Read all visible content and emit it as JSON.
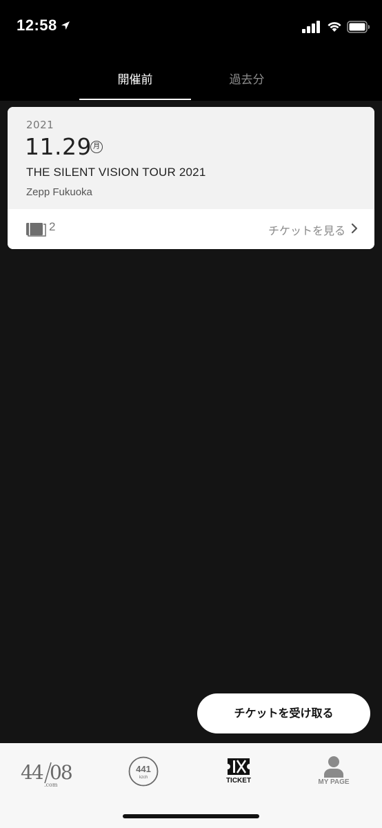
{
  "status_bar": {
    "time": "12:58"
  },
  "tabs": [
    {
      "label": "開催前",
      "selected": true
    },
    {
      "label": "過去分",
      "selected": false
    }
  ],
  "ticket_card": {
    "year": "2021",
    "date": "11.29",
    "weekday": "月",
    "title": "THE SILENT VISION TOUR 2021",
    "venue": "Zepp Fukuoka",
    "ticket_count": "2",
    "view_tickets_label": "チケットを見る"
  },
  "receive_button": {
    "label": "チケットを受け取る"
  },
  "bottom_nav": {
    "items": [
      {
        "icon": "4408-logo-icon",
        "label": ""
      },
      {
        "icon": "kzch-441-icon",
        "label": ""
      },
      {
        "icon": "ticket-icon",
        "label": "TICKET",
        "active": true
      },
      {
        "icon": "person-icon",
        "label": "MY PAGE",
        "active": false
      }
    ]
  },
  "colors": {
    "background": "#141414",
    "header": "#000000",
    "card_top": "#f2f2f2",
    "nav_background": "#f7f7f7",
    "inactive_text": "#8c8c8c"
  }
}
